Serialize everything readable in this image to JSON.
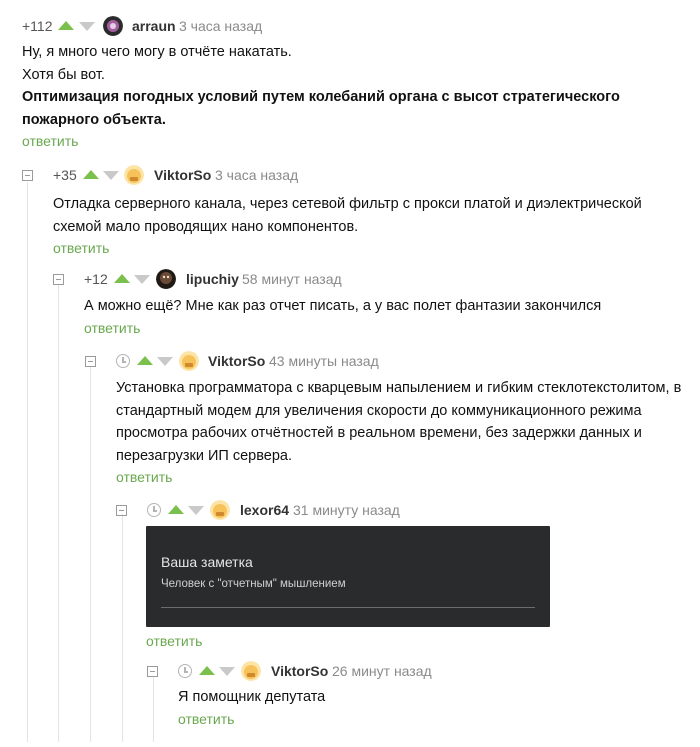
{
  "comments": [
    {
      "rating": "+112",
      "author": "arraun",
      "time": "3 часа назад",
      "lines": [
        "Ну, я много чего могу в отчёте накатать.",
        "Хотя бы вот."
      ],
      "bold_text": "Оптимизация погодных условий путем колебаний органа с высот стратегического пожарного объекта.",
      "reply": "ответить"
    },
    {
      "rating": "+35",
      "author": "ViktorSo",
      "time": "3 часа назад",
      "text": "Отладка серверного канала, через сетевой фильтр с прокси платой и диэлектрической схемой мало проводящих нано компонентов.",
      "reply": "ответить"
    },
    {
      "rating": "+12",
      "author": "lipuchiy",
      "time": "58 минут назад",
      "text": "А можно ещё? Мне как раз отчет писать, а у вас полет фантазии закончился",
      "reply": "ответить"
    },
    {
      "author": "ViktorSo",
      "time": "43 минуты назад",
      "text": "Установка программатора с кварцевым напылением и гибким стеклотекстолитом, в стандартный модем для увеличения скорости до коммуникационного режима просмотра рабочих отчётностей в реальном времени, без задержки данных и перезагрузки ИП сервера.",
      "reply": "ответить"
    },
    {
      "author": "lexor64",
      "time": "31 минуту назад",
      "note": {
        "title": "Ваша заметка",
        "subtitle": "Человек с \"отчетным\" мышлением"
      },
      "reply": "ответить"
    },
    {
      "author": "ViktorSo",
      "time": "26 минут назад",
      "text": "Я помощник депутата",
      "reply": "ответить"
    }
  ],
  "colors": {
    "upvote": "#7bc04c",
    "downvote": "#c9c9c9",
    "reply_link": "#6aa84f",
    "note_bg": "#2a2b2c"
  },
  "icons": {
    "collapse": "collapse-minus-icon",
    "hidden_rating": "clock-icon",
    "upvote": "upvote-arrow-icon",
    "downvote": "downvote-arrow-icon"
  }
}
